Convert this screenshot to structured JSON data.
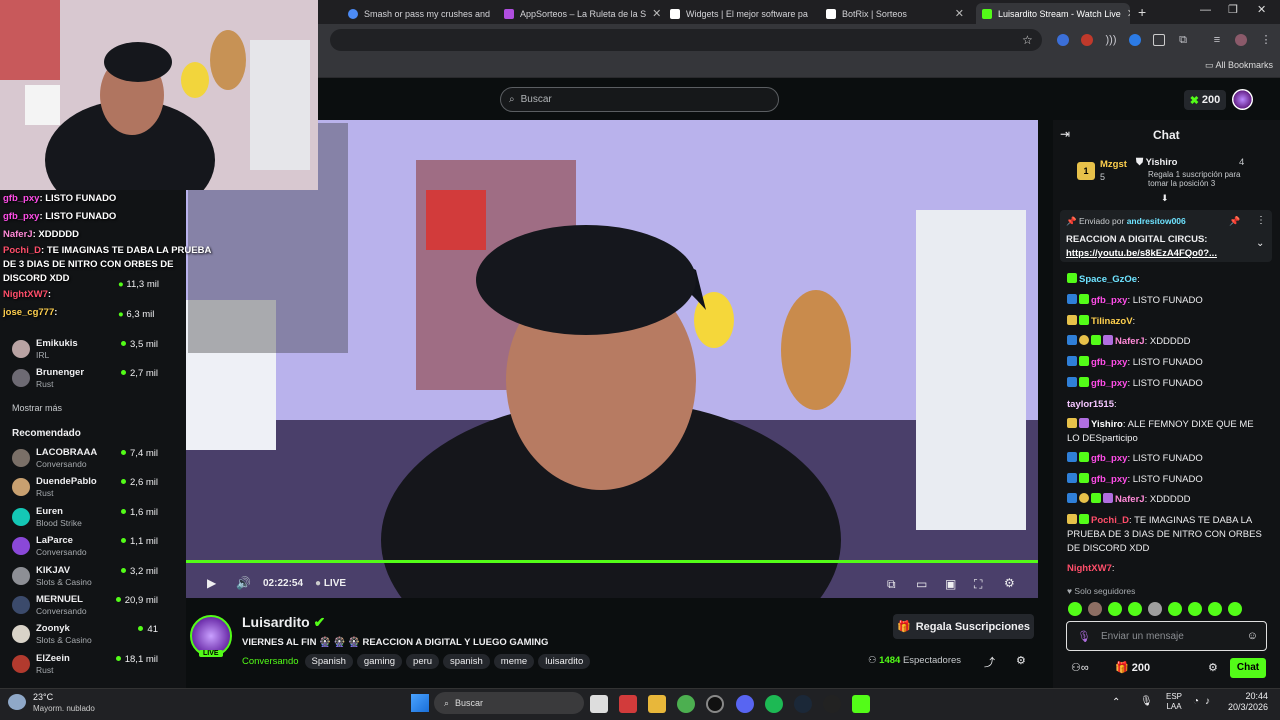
{
  "browser": {
    "tabs": [
      {
        "label": "Smash or pass my crushes and",
        "color": "#4c8bf5"
      },
      {
        "label": "AppSorteos – La Ruleta de la S",
        "color": "#b04ee0"
      },
      {
        "label": "Widgets | El mejor software pa",
        "color": "#ffffff"
      },
      {
        "label": "BotRix | Sorteos",
        "color": "#ffffff"
      },
      {
        "label": "Luisardito Stream - Watch Live",
        "color": "#53fc18"
      }
    ],
    "new_tab": "+",
    "bookmarks_label": "All Bookmarks"
  },
  "kick": {
    "search_placeholder": "Buscar",
    "balance": "200"
  },
  "sidebar": {
    "following": [
      {
        "name": "Emikukis",
        "category": "IRL",
        "count": "3,5 mil",
        "color": "#b9a3a3"
      },
      {
        "name": "Brunenger",
        "category": "Rust",
        "count": "2,7 mil",
        "color": "#6d6a73"
      }
    ],
    "partial_counts": [
      "11,3 mil",
      "6,3 mil"
    ],
    "show_more": "Mostrar más",
    "recommended_title": "Recomendado",
    "recommended": [
      {
        "name": "LACOBRAAA",
        "category": "Conversando",
        "count": "7,4 mil",
        "color": "#7a6f67"
      },
      {
        "name": "DuendePablo",
        "category": "Rust",
        "count": "2,6 mil",
        "color": "#c8a070"
      },
      {
        "name": "Euren",
        "category": "Blood Strike",
        "count": "1,6 mil",
        "color": "#14c7b5"
      },
      {
        "name": "LaParce",
        "category": "Conversando",
        "count": "1,1 mil",
        "color": "#8a48d8"
      },
      {
        "name": "KIKJAV",
        "category": "Slots & Casino",
        "count": "3,2 mil",
        "color": "#8d8f95"
      },
      {
        "name": "MERNUEL",
        "category": "Conversando",
        "count": "20,9 mil",
        "color": "#3b4a6b"
      },
      {
        "name": "Zoonyk",
        "category": "Slots & Casino",
        "count": "41",
        "color": "#d9d3c8"
      },
      {
        "name": "ElZeein",
        "category": "Rust",
        "count": "18,1 mil",
        "color": "#b23a2e"
      }
    ]
  },
  "overlay_chat": [
    {
      "user": "gfb_pxy",
      "text": ": LISTO FUNADO"
    },
    {
      "user": "gfb_pxy",
      "text": ": LISTO FUNADO"
    },
    {
      "user": "NaferJ",
      "text": ": XDDDDD"
    },
    {
      "user": "Pochi_D",
      "text": ": TE IMAGINAS TE DABA LA PRUEBA DE 3 DIAS DE NITRO CON ORBES DE DISCORD XDD"
    },
    {
      "user": "NightXW7",
      "text": ":"
    },
    {
      "user": "jose_cg777",
      "text": ":"
    }
  ],
  "player": {
    "time": "02:22:54",
    "live": "LIVE"
  },
  "stream": {
    "channel": "Luisardito",
    "live_badge": "LIVE",
    "title": "VIERNES AL FIN 🎡 🎡 🎡 REACCION A DIGITAL Y LUEGO GAMING",
    "category": "Conversando",
    "tags": [
      "Spanish",
      "gaming",
      "peru",
      "spanish",
      "meme",
      "luisardito"
    ],
    "gift_button": "Regala Suscripciones",
    "viewers": "1484",
    "viewers_label": "Espectadores"
  },
  "chat": {
    "title": "Chat",
    "leader1_name": "Mzgst",
    "leader1_count": "5",
    "leader2_name": "Yishiro",
    "leader2_count": "4",
    "leader2_sub": "Regala 1 suscripción para tomar la posición 3",
    "pinned_by_label": "Enviado por",
    "pinned_user": "andresitow006",
    "pinned_text": "REACCION A DIGITAL CIRCUS:",
    "pinned_link": "https://youtu.be/s8kEzA4FQo0?...",
    "messages": [
      {
        "user": "Space_GzOe",
        "text": ":",
        "color": "#6ee3ff"
      },
      {
        "user": "gfb_pxy",
        "text": ": LISTO FUNADO",
        "color": "#ff4ee8"
      },
      {
        "user": "TilinazoV",
        "text": ":",
        "color": "#ffd04e"
      },
      {
        "user": "NaferJ",
        "text": ": XDDDDD",
        "color": "#ff8ad8"
      },
      {
        "user": "gfb_pxy",
        "text": ": LISTO FUNADO",
        "color": "#ff4ee8"
      },
      {
        "user": "gfb_pxy",
        "text": ": LISTO FUNADO",
        "color": "#ff4ee8"
      },
      {
        "user": "taylor1515",
        "text": ":",
        "color": "#f4c6ff"
      },
      {
        "user": "Yishiro",
        "text": ": ALE FEMNOY DIXE QUE ME LO DESparticipo",
        "color": "#ffffff"
      },
      {
        "user": "gfb_pxy",
        "text": ": LISTO FUNADO",
        "color": "#ff4ee8"
      },
      {
        "user": "gfb_pxy",
        "text": ": LISTO FUNADO",
        "color": "#ff4ee8"
      },
      {
        "user": "NaferJ",
        "text": ": XDDDDD",
        "color": "#ff8ad8"
      },
      {
        "user": "Pochi_D",
        "text": ": TE IMAGINAS TE DABA LA PRUEBA DE 3 DIAS DE NITRO CON ORBES DE DISCORD XDD",
        "color": "#ff4e6a"
      },
      {
        "user": "NightXW7",
        "text": ":",
        "color": "#ff4e6a"
      }
    ],
    "followers_only": "Solo seguidores",
    "input_placeholder": "Enviar un mensaje",
    "balance": "200",
    "send_button": "Chat"
  },
  "taskbar": {
    "temp": "23°C",
    "weather": "Mayorm. nublado",
    "search": "Buscar",
    "lang1": "ESP",
    "lang2": "LAA",
    "time": "20:44",
    "date": "20/3/2026"
  }
}
